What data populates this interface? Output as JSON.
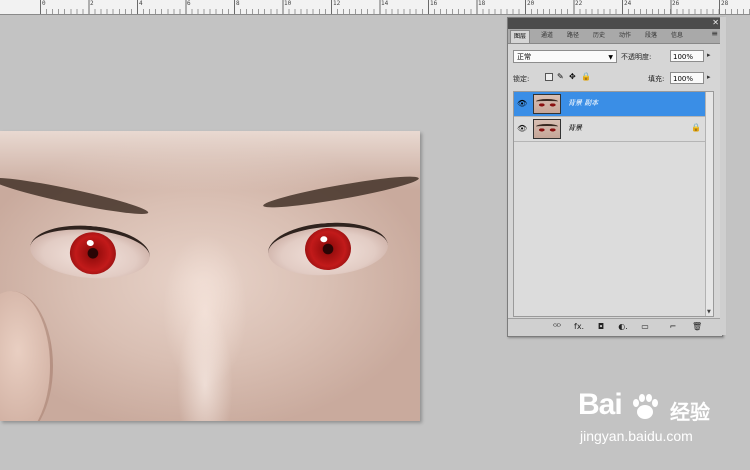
{
  "ruler": {
    "numbers": [
      "0",
      "2",
      "4",
      "6",
      "8",
      "10",
      "12",
      "14",
      "16",
      "18",
      "20",
      "22",
      "24",
      "26",
      "28",
      "30"
    ]
  },
  "canvas": {
    "image_description_icon": "portrait-red-eyes-image"
  },
  "layers_panel": {
    "tabs": [
      "图层",
      "通道",
      "路径",
      "历史",
      "动作",
      "段落",
      "信息"
    ],
    "blend_mode": "正常",
    "opacity_label": "不透明度:",
    "opacity_value": "100%",
    "lock_label": "锁定:",
    "fill_label": "填充:",
    "fill_value": "100%",
    "layers": [
      {
        "name": "背景 副本",
        "selected": true,
        "visible": true,
        "locked": false
      },
      {
        "name": "背景",
        "selected": false,
        "visible": true,
        "locked": true
      }
    ],
    "bottom_icons": [
      "link-icon",
      "fx-icon",
      "mask-icon",
      "adjustment-icon",
      "group-icon",
      "new-layer-icon",
      "trash-icon"
    ],
    "bottom_glyphs": [
      "ᴳᴰ",
      "fx.",
      "◘",
      "◐.",
      "▭",
      "⌐",
      "🗑"
    ],
    "selection_color": "#3a8ee6"
  },
  "watermark": {
    "brand": "Bai",
    "brand2": "经验",
    "url": "jingyan.baidu.com"
  }
}
